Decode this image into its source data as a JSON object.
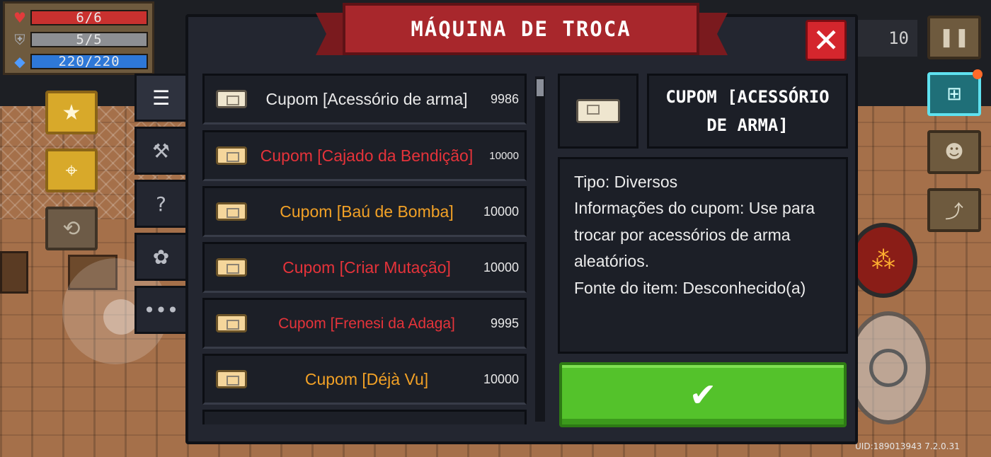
{
  "hud": {
    "hp": "6/6",
    "armor": "5/5",
    "energy": "220/220",
    "gems": "10",
    "uid": "UID:189013943 7.2.0.31"
  },
  "modal": {
    "title": "MÁQUINA DE TROCA",
    "close_label": "✕",
    "confirm_label": "✔"
  },
  "tabs": [
    {
      "icon": "list-icon",
      "glyph": "☰"
    },
    {
      "icon": "weapon-icon",
      "glyph": "🔫"
    },
    {
      "icon": "question-icon",
      "glyph": "?"
    },
    {
      "icon": "plant-icon",
      "glyph": "✿"
    },
    {
      "icon": "more-icon",
      "glyph": "•••"
    }
  ],
  "items": [
    {
      "name": "Cupom [Acessório de arma]",
      "count": "9986",
      "color": "#e9e9e9"
    },
    {
      "name": "Cupom [Cajado da Bendição]",
      "count": "10000",
      "color": "#e5333a"
    },
    {
      "name": "Cupom [Baú de Bomba]",
      "count": "10000",
      "color": "#f2a126"
    },
    {
      "name": "Cupom [Criar Mutação]",
      "count": "10000",
      "color": "#e5333a"
    },
    {
      "name": "Cupom [Frenesi da Adaga]",
      "count": "9995",
      "color": "#e5333a"
    },
    {
      "name": "Cupom [Déjà Vu]",
      "count": "10000",
      "color": "#f2a126"
    }
  ],
  "detail": {
    "title": "CUPOM [ACESSÓRIO DE ARMA]",
    "type": "Tipo: Diversos",
    "info": "Informações do cupom: Use para trocar por acessórios de arma aleatórios.",
    "source": "Fonte do item: Desconhecido(a)"
  },
  "colors": {
    "accent_red": "#a8272c",
    "confirm_green": "#54c22b",
    "panel": "#232630"
  }
}
